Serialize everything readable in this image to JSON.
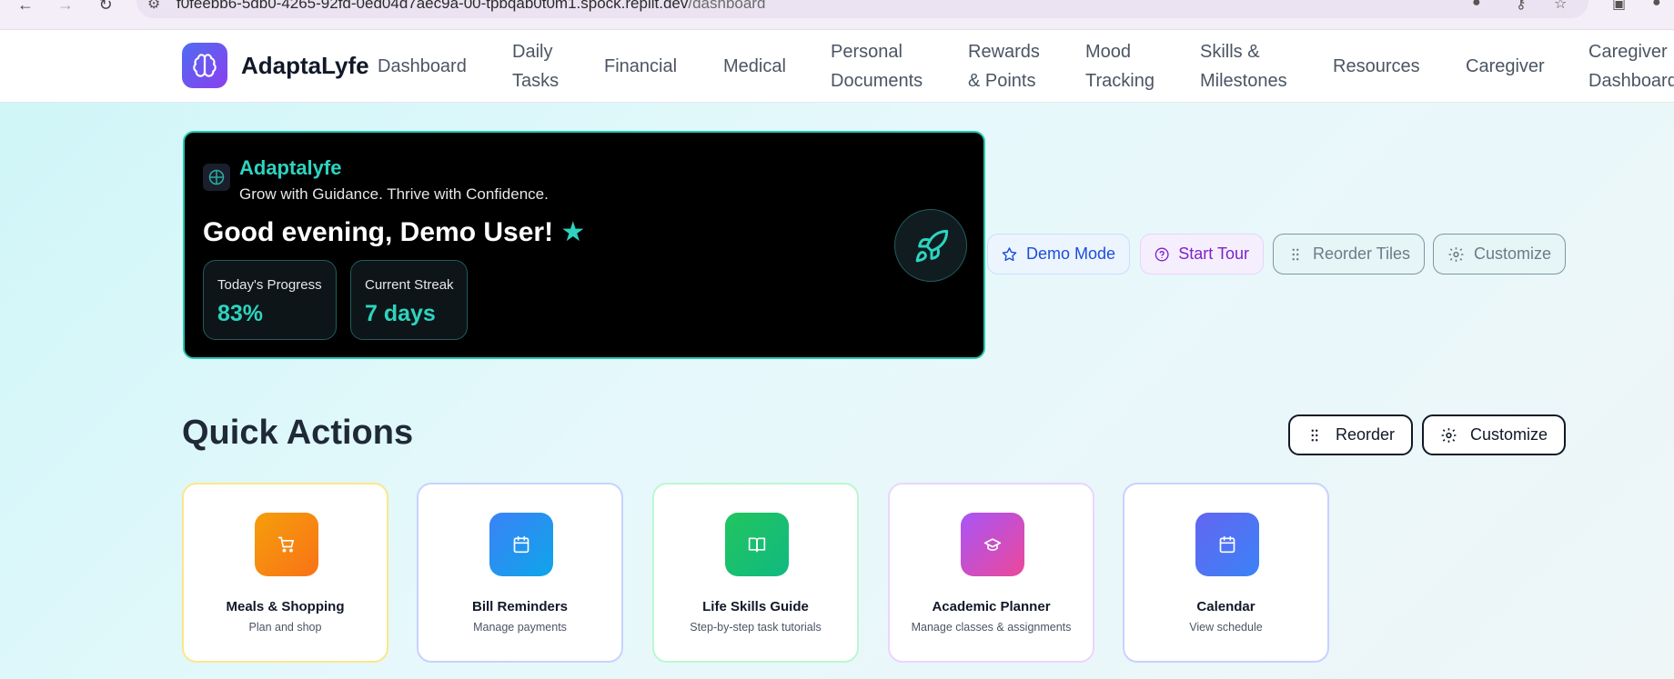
{
  "browser": {
    "url_host": "f0feebb6-5db0-4265-92fd-0ed04d7aec9a-00-tpbqab0t0m1.spock.replit.dev",
    "url_path": "/dashboard"
  },
  "nav": {
    "brand": "AdaptaLyfe",
    "items": [
      {
        "label": "Dashboard"
      },
      {
        "label": "Daily Tasks"
      },
      {
        "label": "Financial"
      },
      {
        "label": "Medical"
      },
      {
        "label": "Personal Documents"
      },
      {
        "label": "Rewards & Points"
      },
      {
        "label": "Mood Tracking"
      },
      {
        "label": "Skills & Milestones"
      },
      {
        "label": "Resources"
      },
      {
        "label": "Caregiver"
      },
      {
        "label": "Caregiver Dashboard"
      }
    ]
  },
  "hero": {
    "brand": "Adaptalyfe",
    "tagline": "Grow with Guidance. Thrive with Confidence.",
    "greeting": "Good evening, Demo User!",
    "star": "★",
    "stats": [
      {
        "label": "Today's Progress",
        "value": "83%"
      },
      {
        "label": "Current Streak",
        "value": "7 days"
      }
    ]
  },
  "side_buttons": {
    "demo_mode": "Demo Mode",
    "start_tour": "Start Tour",
    "reorder_tiles": "Reorder Tiles",
    "customize": "Customize"
  },
  "quick_actions": {
    "title": "Quick Actions",
    "reorder": "Reorder",
    "customize": "Customize",
    "tiles": [
      {
        "title": "Meals & Shopping",
        "subtitle": "Plan and shop",
        "icon": "cart-icon"
      },
      {
        "title": "Bill Reminders",
        "subtitle": "Manage payments",
        "icon": "calendar-icon"
      },
      {
        "title": "Life Skills Guide",
        "subtitle": "Step-by-step task tutorials",
        "icon": "book-icon"
      },
      {
        "title": "Academic Planner",
        "subtitle": "Manage classes & assignments",
        "icon": "graduation-cap-icon"
      },
      {
        "title": "Calendar",
        "subtitle": "View schedule",
        "icon": "calendar-icon"
      }
    ]
  },
  "colors": {
    "accent_teal": "#2dd4bf",
    "brand_gradient_start": "#4f6cf0",
    "brand_gradient_end": "#8b3ff0"
  }
}
